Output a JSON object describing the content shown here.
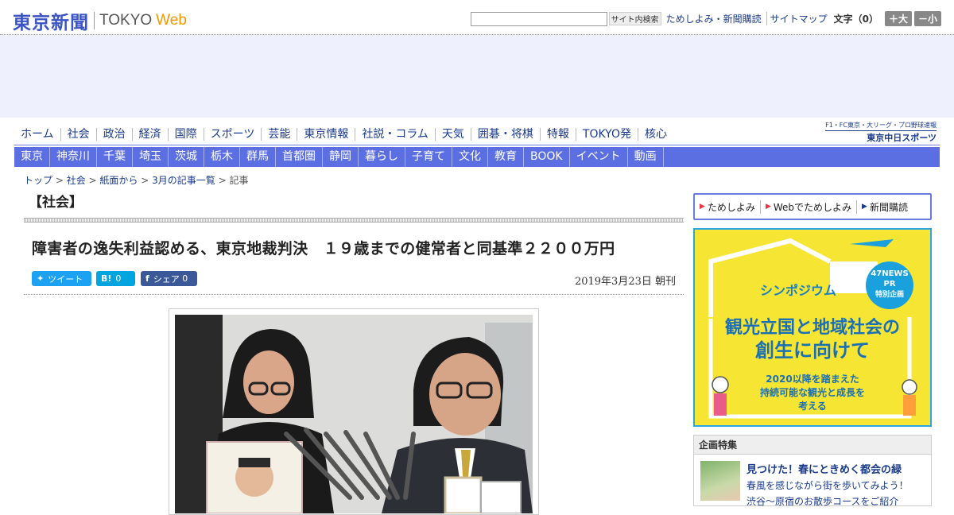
{
  "header": {
    "logo_jp": "東京新聞",
    "logo_tokyo": "TOKYO",
    "logo_web": "Web",
    "search_button": "サイト内検索",
    "links": [
      "ためしよみ・新聞購読",
      "サイトマップ"
    ],
    "font_size_label": "文字（0）",
    "bigger": "＋大",
    "smaller": "－小"
  },
  "nav_main": [
    "ホーム",
    "社会",
    "政治",
    "経済",
    "国際",
    "スポーツ",
    "芸能",
    "東京情報",
    "社説・コラム",
    "天気",
    "囲碁・将棋",
    "特報",
    "TOKYO発",
    "核心"
  ],
  "sports_link": {
    "line1": "F1・FC東京・大リーグ・プロ野球速報",
    "line2": "東京中日スポーツ"
  },
  "nav_region": [
    "東京",
    "神奈川",
    "千葉",
    "埼玉",
    "茨城",
    "栃木",
    "群馬",
    "首都圏",
    "静岡",
    "暮らし",
    "子育て",
    "文化",
    "教育",
    "BOOK",
    "イベント",
    "動画"
  ],
  "breadcrumb": [
    "トップ",
    "社会",
    "紙面から",
    "3月の記事一覧",
    "記事"
  ],
  "article": {
    "section": "【社会】",
    "headline": "障害者の逸失利益認める、東京地裁判決　１９歳までの健常者と同基準２２００万円",
    "date": "2019年3月23日 朝刊",
    "share": {
      "tweet": "ツイート",
      "hatena_icon": "B!",
      "hatena_count": "0",
      "fb_icon": "f",
      "fb_label": "シェア",
      "fb_count": "0"
    }
  },
  "sidebar": {
    "links": [
      "ためしよみ",
      "Webでためしよみ",
      "新聞購読"
    ],
    "ad": {
      "badge1": "47NEWS",
      "badge2": "PR",
      "badge3": "特別企画",
      "symposium": "シンポジウム",
      "title1": "観光立国と地域社会の",
      "title2": "創生に向けて",
      "sub1": "2020以降を踏まえた",
      "sub2": "持続可能な観光と成長を",
      "sub3": "考える"
    },
    "kikaku": {
      "header": "企画特集",
      "title": "見つけた！春にときめく都会の緑",
      "text1": "春風を感じながら街を歩いてみよう！",
      "text2": "渋谷～原宿のお散歩コースをご紹介"
    }
  },
  "colors": {
    "brand": "#3a53c5",
    "nav_bar": "#5b6ee2",
    "ad_bg": "#eef1fd",
    "web_orange": "#f39800"
  }
}
